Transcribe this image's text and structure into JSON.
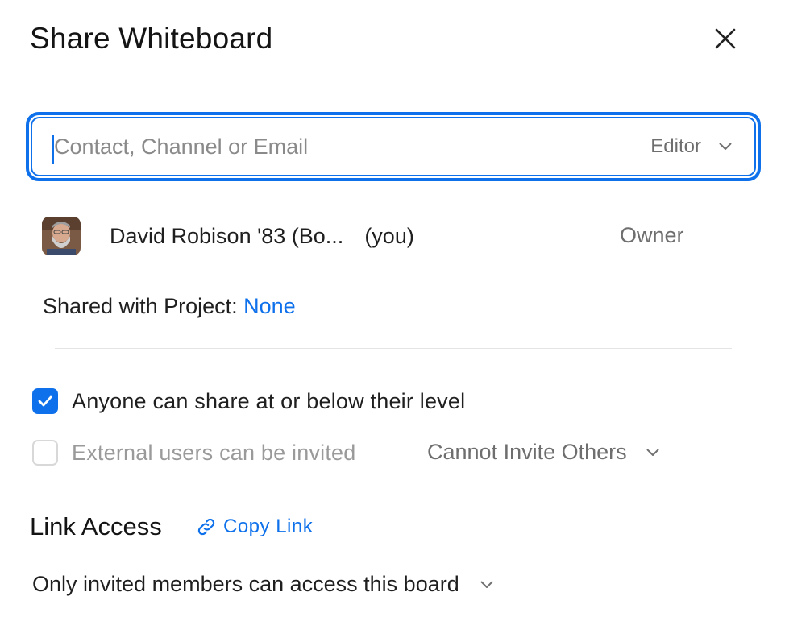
{
  "dialog": {
    "title": "Share Whiteboard"
  },
  "invite": {
    "placeholder": "Contact, Channel or Email",
    "value": "",
    "role": "Editor"
  },
  "members": [
    {
      "name": "David Robison '83 (Bo...",
      "you_label": "(you)",
      "role": "Owner"
    }
  ],
  "project": {
    "label": "Shared with Project:",
    "value": "None"
  },
  "permissions": {
    "share_below": {
      "label": "Anyone can share at or below their level",
      "checked": true
    },
    "external": {
      "label": "External users can be invited",
      "checked": false,
      "invite_option": "Cannot Invite Others"
    }
  },
  "link_access": {
    "title": "Link Access",
    "copy_label": "Copy Link",
    "access_option": "Only invited members can access this board"
  },
  "colors": {
    "accent": "#0e71eb",
    "muted_text": "#6e6e6e",
    "disabled_text": "#9a9a9a"
  }
}
